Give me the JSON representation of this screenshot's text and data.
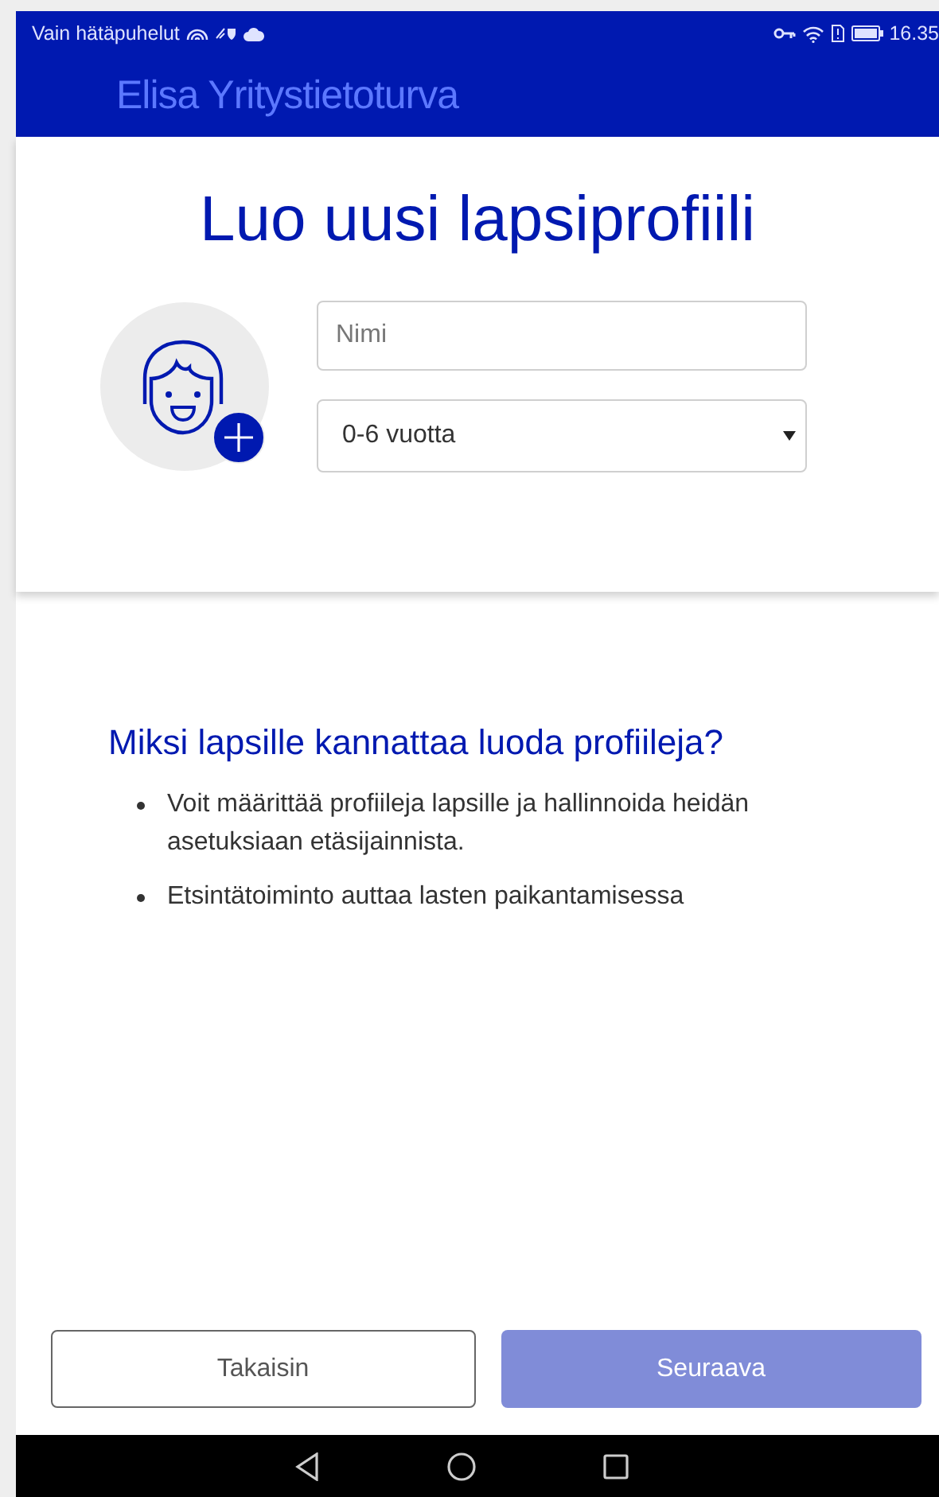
{
  "status_bar": {
    "carrier": "Vain hätäpuhelut",
    "time": "16.35"
  },
  "app_bar": {
    "title": "Elisa Yritystietoturva"
  },
  "form": {
    "title": "Luo uusi lapsiprofiili",
    "name_field": {
      "placeholder": "Nimi"
    },
    "age_select": {
      "value": "0-6 vuotta"
    }
  },
  "info": {
    "heading": "Miksi lapsille kannattaa luoda profiileja?",
    "bullets": [
      "Voit määrittää profiileja lapsille ja hallinnoida heidän asetuksiaan etäsijainnista.",
      "Etsintätoiminto auttaa lasten paikantamisessa"
    ]
  },
  "buttons": [
    {
      "label": "Takaisin",
      "kind": "secondary",
      "disabled": false
    },
    {
      "label": "Seuraava",
      "kind": "primary",
      "disabled": true
    }
  ]
}
